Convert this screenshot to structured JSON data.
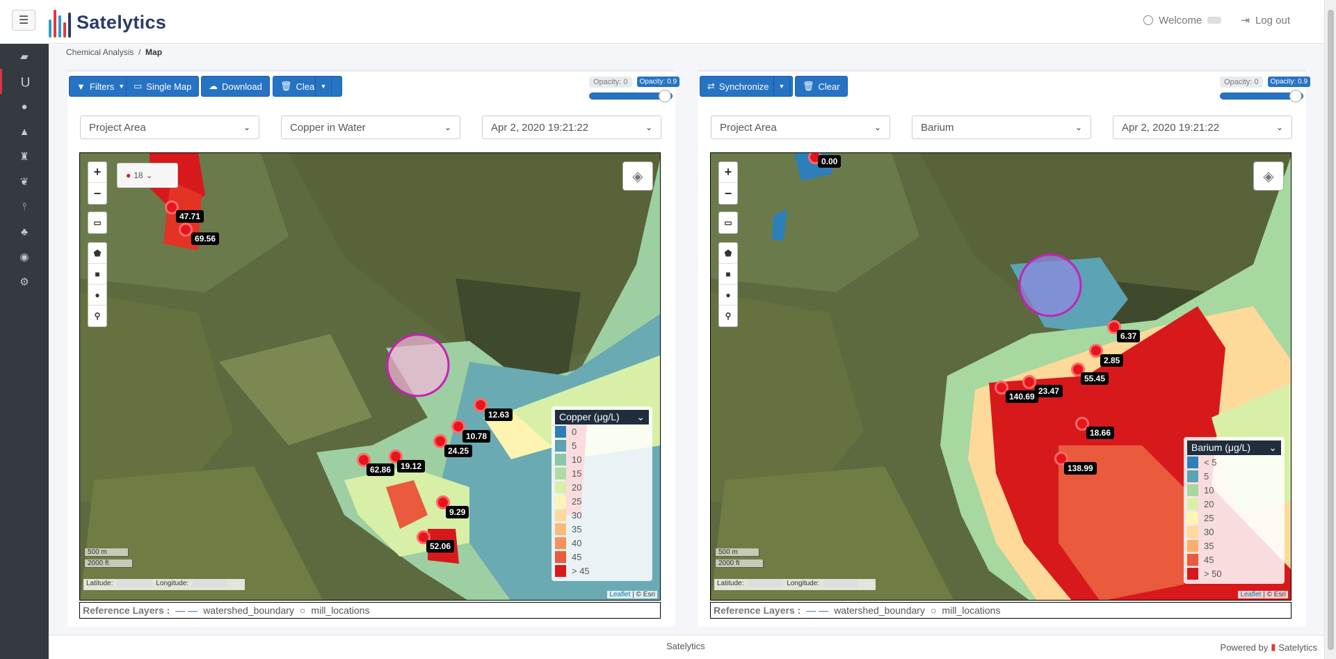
{
  "header": {
    "brand": "Satelytics",
    "welcome": "Welcome",
    "logout": "Log out"
  },
  "breadcrumb": {
    "parent": "Chemical Analysis",
    "current": "Map"
  },
  "sidebar": {
    "items": [
      "folder-icon",
      "magnet-icon",
      "droplet-icon",
      "warning-icon",
      "flask-icon",
      "leaf-icon",
      "thermometer-icon",
      "tree-icon",
      "user-circle-icon",
      "cogs-icon"
    ],
    "active_index": 1
  },
  "left": {
    "buttons": {
      "filters": "Filters",
      "single_map": "Single Map",
      "download": "Download",
      "clear": "Clear"
    },
    "opacity": {
      "min_label": "Opacity: 0",
      "max_label": "Opacity: 0.9",
      "value": 0.9
    },
    "selects": {
      "area": "Project Area",
      "chemical": "Copper in Water",
      "date": "Apr 2, 2020 19:21:22"
    },
    "marker_count": "18",
    "labels": [
      "47.71",
      "69.56",
      "12.63",
      "10.78",
      "24.25",
      "62.86",
      "19.12",
      "9.29",
      "52.06"
    ],
    "legend": {
      "title": "Copper (μg/L)",
      "items": [
        {
          "label": "0",
          "color": "#2c7fb8"
        },
        {
          "label": "5",
          "color": "#5ba3b5"
        },
        {
          "label": "10",
          "color": "#8cc5a8"
        },
        {
          "label": "15",
          "color": "#b0dba0"
        },
        {
          "label": "20",
          "color": "#d8efa8"
        },
        {
          "label": "25",
          "color": "#fcf4b0"
        },
        {
          "label": "30",
          "color": "#fdd99a"
        },
        {
          "label": "35",
          "color": "#fdb97d"
        },
        {
          "label": "40",
          "color": "#f6915c"
        },
        {
          "label": "45",
          "color": "#ea5a3c"
        },
        {
          "label": "> 45",
          "color": "#d7191c"
        }
      ]
    }
  },
  "right": {
    "buttons": {
      "synchronize": "Synchronize",
      "clear": "Clear"
    },
    "opacity": {
      "min_label": "Opacity: 0",
      "max_label": "Opacity: 0.9",
      "value": 0.9
    },
    "selects": {
      "area": "Project Area",
      "chemical": "Barium",
      "date": "Apr 2, 2020 19:21:22"
    },
    "labels": [
      "0.00",
      "6.37",
      "2.85",
      "55.45",
      "140.69",
      "23.47",
      "18.66",
      "138.99"
    ],
    "legend": {
      "title": "Barium (μg/L)",
      "items": [
        {
          "label": "< 5",
          "color": "#2c7fb8"
        },
        {
          "label": "5",
          "color": "#5ba3b5"
        },
        {
          "label": "10",
          "color": "#a6d8a0"
        },
        {
          "label": "20",
          "color": "#d8efa8"
        },
        {
          "label": "25",
          "color": "#fcf8b0"
        },
        {
          "label": "30",
          "color": "#fdd99a"
        },
        {
          "label": "35",
          "color": "#fdae6b"
        },
        {
          "label": "45",
          "color": "#ea5a3c"
        },
        {
          "label": "> 50",
          "color": "#d7191c"
        }
      ]
    }
  },
  "map_common": {
    "scale_m": "500 m",
    "scale_ft": "2000 ft",
    "latitude": "Latitude:",
    "longitude": "Longitude:",
    "attr_leaflet": "Leaflet",
    "attr_esri": "| © Esri"
  },
  "reference": {
    "title": "Reference Layers :",
    "layer1": "watershed_boundary",
    "layer2": "mill_locations"
  },
  "footer": {
    "center": "Satelytics",
    "powered": "Powered by",
    "brand": "Satelytics"
  }
}
